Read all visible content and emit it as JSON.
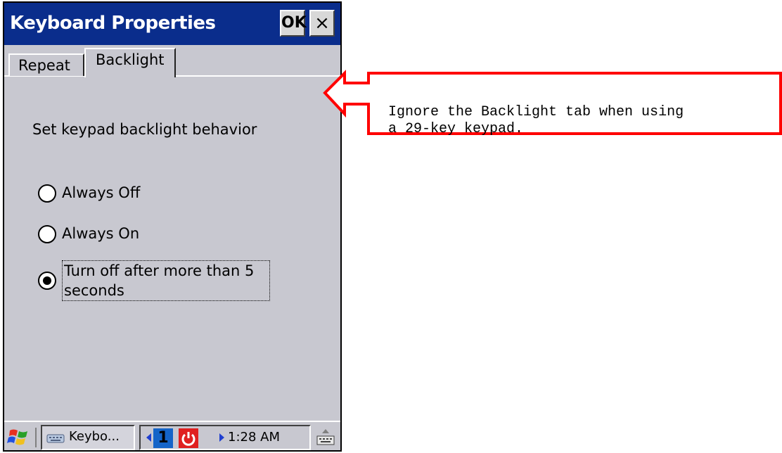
{
  "window": {
    "title": "Keyboard Properties",
    "ok_label": "OK",
    "close_label": "×"
  },
  "tabs": [
    {
      "label": "Repeat",
      "active": false
    },
    {
      "label": "Backlight",
      "active": true
    }
  ],
  "backlight": {
    "instruction": "Set keypad backlight behavior",
    "options": [
      {
        "label": "Always Off",
        "selected": false
      },
      {
        "label": "Always On",
        "selected": false
      },
      {
        "label": "Turn off after more than 5 seconds",
        "selected": true
      }
    ]
  },
  "taskbar": {
    "task_label": "Keybo...",
    "input_mode": "1",
    "time": "1:28 AM",
    "icons": [
      "windows-start-icon",
      "keyboard-app-icon",
      "power-icon",
      "soft-keyboard-icon",
      "desktop-switch-icon"
    ]
  },
  "callout": {
    "text": "Ignore the Backlight tab when using\na 29-key keypad.",
    "border_color": "#ff0000"
  },
  "colors": {
    "titlebar": "#0a2d8c",
    "window_bg": "#c8c8d0",
    "accent_red": "#ff0000"
  }
}
